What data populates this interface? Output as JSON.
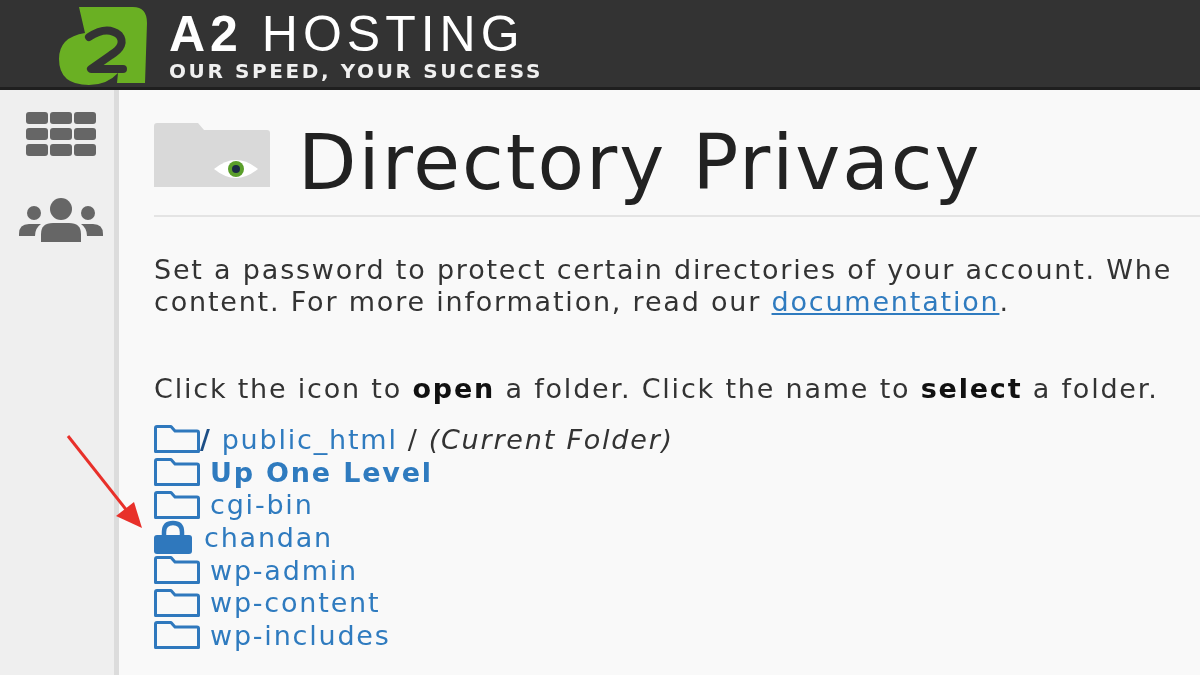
{
  "header": {
    "brand": "**A2** HOSTING",
    "tagline": "OUR SPEED, YOUR SUCCESS"
  },
  "page": {
    "title": "Directory Privacy"
  },
  "intro": {
    "line_1": "Set a password to protect certain directories of your account. Whe",
    "line_2": "content. For more information, read our",
    "link": "documentation",
    "line_2_end": "."
  },
  "instructions": "Click the icon to **open** a folder. Click the name to **select** a folder.",
  "folders": [
    {
      "kind": "current",
      "root": "/",
      "name": "public_html",
      "separator": "/",
      "note": "(Current Folder)",
      "locked": false
    },
    {
      "kind": "parent",
      "name": "Up One Level",
      "locked": false
    },
    {
      "kind": "folder",
      "name": "cgi-bin",
      "locked": false
    },
    {
      "kind": "folder",
      "name": "chandan",
      "locked": true
    },
    {
      "kind": "folder",
      "name": "wp-admin",
      "locked": false
    },
    {
      "kind": "folder",
      "name": "wp-content",
      "locked": false
    },
    {
      "kind": "folder",
      "name": "wp-includes",
      "locked": false
    }
  ]
}
